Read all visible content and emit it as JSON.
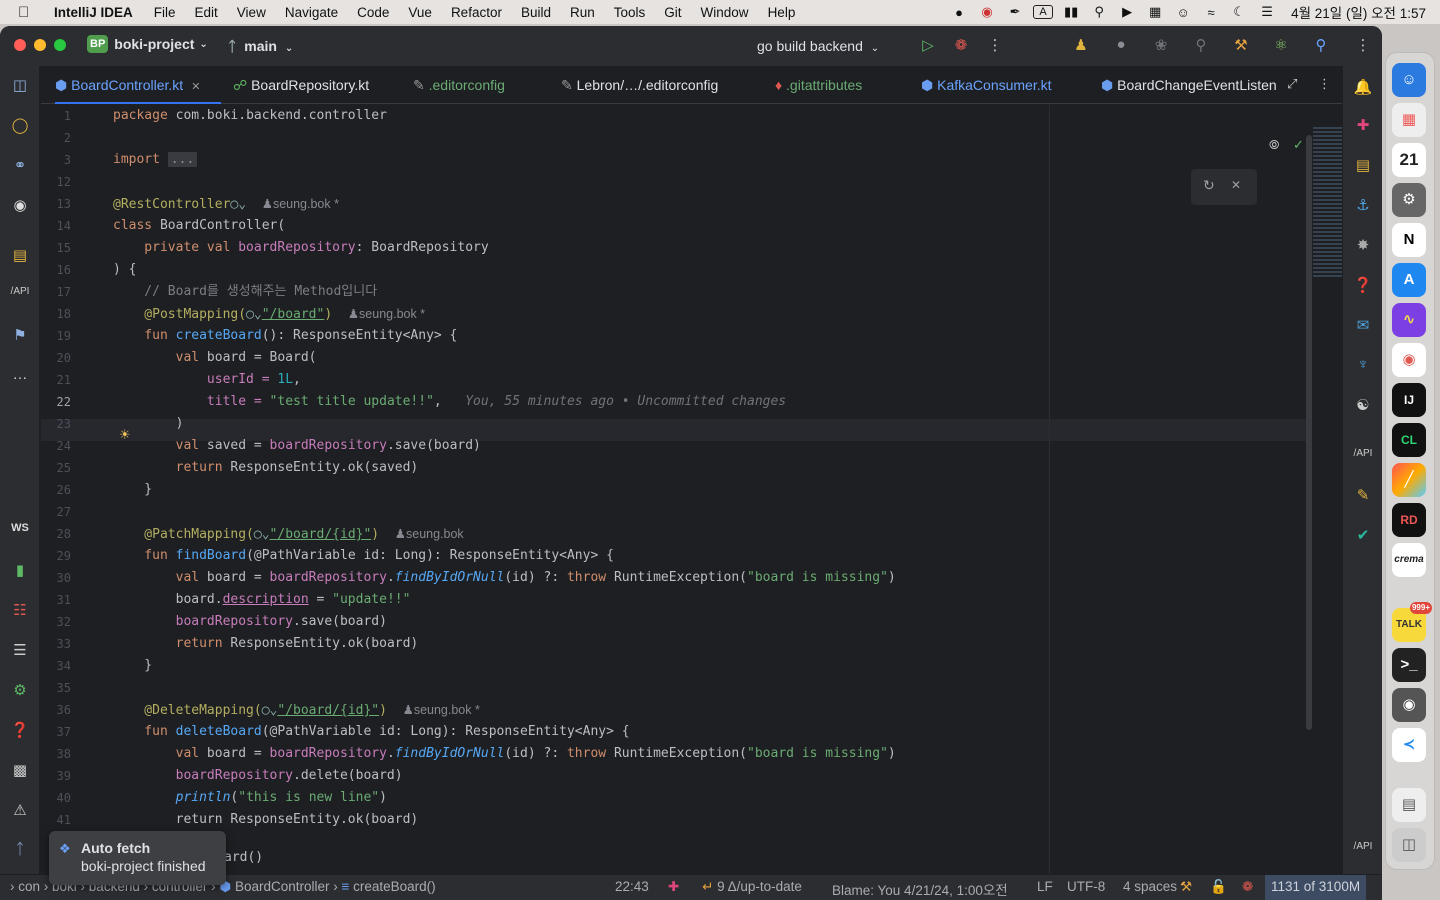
{
  "menubar": {
    "app": "IntelliJ IDEA",
    "items": [
      "File",
      "Edit",
      "View",
      "Navigate",
      "Code",
      "Vue",
      "Refactor",
      "Build",
      "Run",
      "Tools",
      "Git",
      "Window",
      "Help"
    ],
    "clock": "4월 21일 (일) 오전 1:57"
  },
  "title": {
    "badge": "BP",
    "project": "boki-project",
    "branch": "main",
    "run_config": "go build backend"
  },
  "tabs": [
    "BoardController.kt",
    "BoardRepository.kt",
    ".editorconfig",
    "Lebron/…/.editorconfig",
    ".gitattributes",
    "KafkaConsumer.kt",
    "BoardChangeEventListen"
  ],
  "gutter": [
    "1",
    "2",
    "3",
    "12",
    "13",
    "14",
    "15",
    "16",
    "17",
    "18",
    "19",
    "20",
    "21",
    "22",
    "23",
    "24",
    "25",
    "26",
    "27",
    "28",
    "29",
    "30",
    "31",
    "32",
    "33",
    "34",
    "35",
    "36",
    "37",
    "38",
    "39",
    "40",
    "41"
  ],
  "code": {
    "l0": "package com.boki.backend.controller",
    "imp_kw": "import",
    "imp_dots": "...",
    "l_rc": "@RestController",
    "author1": "seung.bok *",
    "class_kw": "class",
    "class_name": " BoardController(",
    "priv": "    private val ",
    "repo_prop": "boardRepository",
    ": BoardRepository": ": BoardRepository",
    "close_brace": ") {",
    "comment1": "    // Board를 생성해주는 Method입니다",
    "post_ann": "    @PostMapping(",
    "post_path": "\"/board\"",
    "post_close": ")",
    "author2": "seung.bok *",
    "fun_kw": "    fun ",
    "createBoard": "createBoard",
    "sig1": "(): ResponseEntity<Any> {",
    "val_board": "        val board = Board(",
    "userId": "            userId = ",
    "one": "1L",
    ",": ",",
    "title": "            title = ",
    "title_str": "\"test title update!!\"",
    "comma": ",",
    "blame": "You, 55 minutes ago • Uncommitted changes",
    "paren": "        )",
    "val_saved": "        val saved = ",
    "save_call": ".save(board)",
    "ret_ok_saved": "        return ResponseEntity.ok(saved)",
    "brace_close": "    }",
    "patch_ann": "    @PatchMapping(",
    "patch_path": "\"/board/{id}\"",
    "author3": "seung.bok",
    "findBoard": "findBoard",
    "path_var": "(@PathVariable id: Long): ResponseEntity<Any> {",
    "find_call": "findByIdOrNull",
    "find_rest": "(id) ?: ",
    "throw": "throw",
    "rte": " RuntimeException(",
    "missing": "\"board is missing\"",
    "desc": "description",
    "update_str": "\"update!!\"",
    "del_ann": "    @DeleteMapping(",
    "author4": "seung.bok *",
    "deleteBoard": "deleteBoard",
    "delete_call": ".delete(board)",
    "println": "println",
    "new_line": "\"this is new line\"",
    "ret_board": "        return ResponseEntity.ok(board)"
  },
  "status": {
    "crumbs": [
      "con",
      "boki",
      "backend",
      "controller",
      "BoardController",
      "createBoard()"
    ],
    "pos": "22:43",
    "vcs": "9 Δ/up-to-date",
    "blame": "Blame: You 4/21/24, 1:00오전",
    "lf": "LF",
    "enc": "UTF-8",
    "indent": "4 spaces",
    "mem": "1131 of 3100M"
  },
  "toast": {
    "title": "Auto fetch",
    "body": "boki-project finished",
    "behind": "ard()"
  },
  "dock": {
    "calendar_day": "21",
    "talk_badge": "999+"
  }
}
